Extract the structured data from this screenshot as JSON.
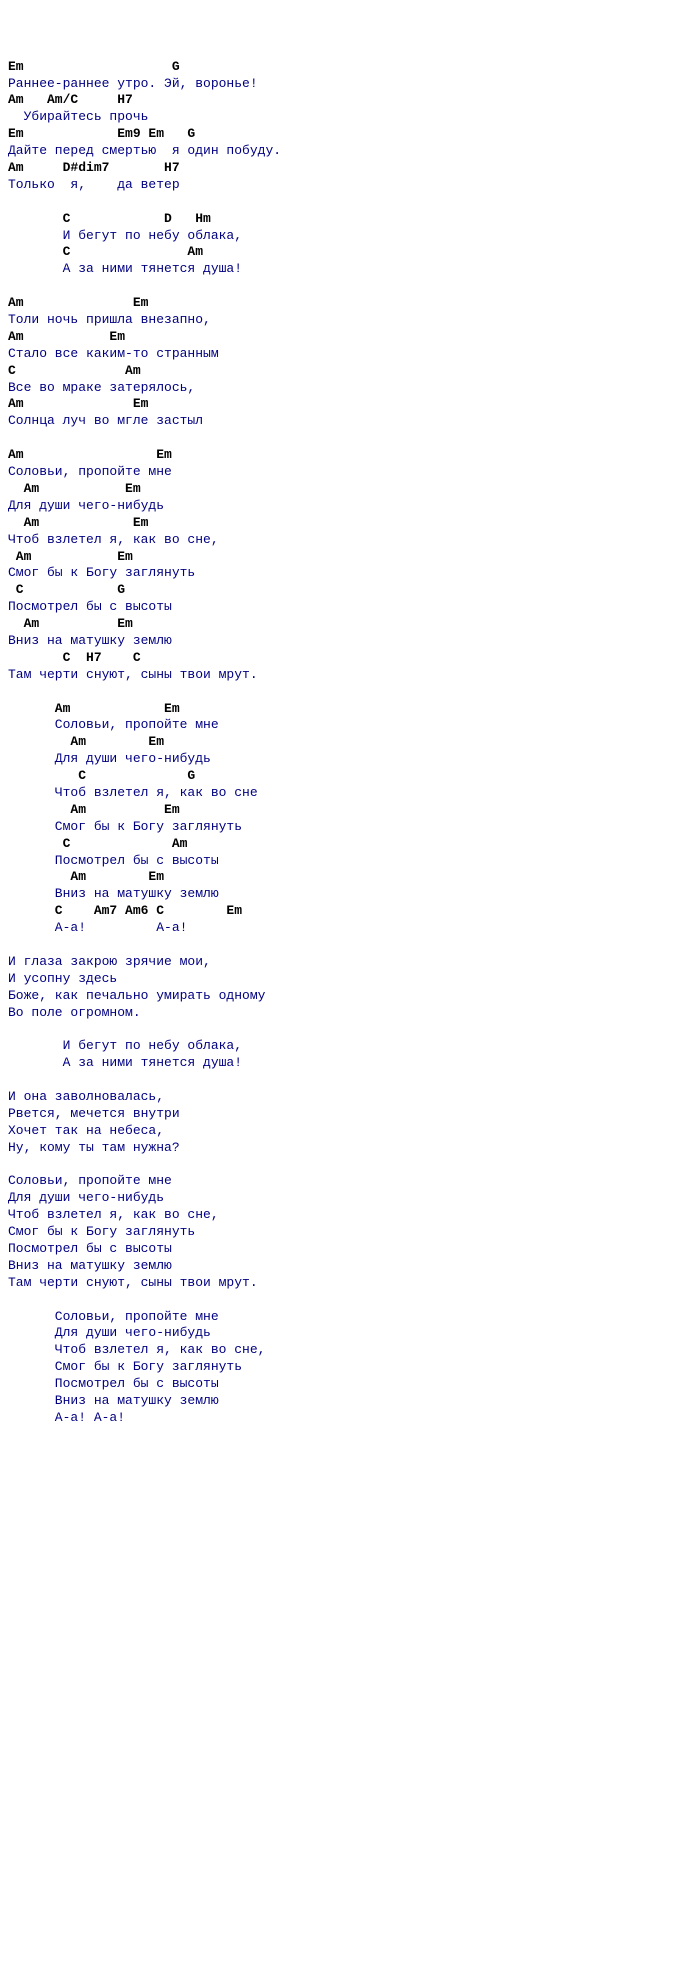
{
  "lines": [
    {
      "type": "chord",
      "text": "Em                   G"
    },
    {
      "type": "lyric",
      "text": "Раннее-раннее утро. Эй, воронье!"
    },
    {
      "type": "chord",
      "text": "Am   Am/C     H7"
    },
    {
      "type": "lyric",
      "text": "  Убирайтесь прочь"
    },
    {
      "type": "chord",
      "text": "Em            Em9 Em   G"
    },
    {
      "type": "lyric",
      "text": "Дайте перед смертью  я один побуду."
    },
    {
      "type": "chord",
      "text": "Am     D#dim7       H7"
    },
    {
      "type": "lyric",
      "text": "Только  я,    да ветер"
    },
    {
      "type": "blank",
      "text": ""
    },
    {
      "type": "chord",
      "text": "       C            D   Hm"
    },
    {
      "type": "lyric",
      "text": "       И бегут по небу облака,"
    },
    {
      "type": "chord",
      "text": "       C               Am"
    },
    {
      "type": "lyric",
      "text": "       А за ними тянется душа!"
    },
    {
      "type": "blank",
      "text": ""
    },
    {
      "type": "chord",
      "text": "Am              Em"
    },
    {
      "type": "lyric",
      "text": "Толи ночь пришла внезапно,"
    },
    {
      "type": "chord",
      "text": "Am           Em"
    },
    {
      "type": "lyric",
      "text": "Стало все каким-то странным"
    },
    {
      "type": "chord",
      "text": "C              Am"
    },
    {
      "type": "lyric",
      "text": "Все во мраке затерялось,"
    },
    {
      "type": "chord",
      "text": "Am              Em"
    },
    {
      "type": "lyric",
      "text": "Солнца луч во мгле застыл"
    },
    {
      "type": "blank",
      "text": ""
    },
    {
      "type": "chord",
      "text": "Am                 Em"
    },
    {
      "type": "lyric",
      "text": "Соловьи, пропойте мне"
    },
    {
      "type": "chord",
      "text": "  Am           Em"
    },
    {
      "type": "lyric",
      "text": "Для души чего-нибудь"
    },
    {
      "type": "chord",
      "text": "  Am            Em"
    },
    {
      "type": "lyric",
      "text": "Чтоб взлетел я, как во сне,"
    },
    {
      "type": "chord",
      "text": " Am           Em"
    },
    {
      "type": "lyric",
      "text": "Смог бы к Богу заглянуть"
    },
    {
      "type": "chord",
      "text": " C            G"
    },
    {
      "type": "lyric",
      "text": "Посмотрел бы с высоты"
    },
    {
      "type": "chord",
      "text": "  Am          Em"
    },
    {
      "type": "lyric",
      "text": "Вниз на матушку землю"
    },
    {
      "type": "chord",
      "text": "       C  H7    C"
    },
    {
      "type": "lyric",
      "text": "Там черти снуют, сыны твои мрут."
    },
    {
      "type": "blank",
      "text": ""
    },
    {
      "type": "chord",
      "text": "      Am            Em"
    },
    {
      "type": "lyric",
      "text": "      Соловьи, пропойте мне"
    },
    {
      "type": "chord",
      "text": "        Am        Em"
    },
    {
      "type": "lyric",
      "text": "      Для души чего-нибудь"
    },
    {
      "type": "chord",
      "text": "         C             G"
    },
    {
      "type": "lyric",
      "text": "      Чтоб взлетел я, как во сне"
    },
    {
      "type": "chord",
      "text": "        Am          Em"
    },
    {
      "type": "lyric",
      "text": "      Смог бы к Богу заглянуть"
    },
    {
      "type": "chord",
      "text": "       C             Am"
    },
    {
      "type": "lyric",
      "text": "      Посмотрел бы с высоты"
    },
    {
      "type": "chord",
      "text": "        Am        Em"
    },
    {
      "type": "lyric",
      "text": "      Вниз на матушку землю"
    },
    {
      "type": "chord",
      "text": "      C    Am7 Am6 C        Em"
    },
    {
      "type": "lyric",
      "text": "      А-а!         А-а!"
    },
    {
      "type": "blank",
      "text": ""
    },
    {
      "type": "lyric",
      "text": "И глаза закрою зрячие мои,"
    },
    {
      "type": "lyric",
      "text": "И усопну здесь"
    },
    {
      "type": "lyric",
      "text": "Боже, как печально умирать одному"
    },
    {
      "type": "lyric",
      "text": "Во поле огромном."
    },
    {
      "type": "blank",
      "text": ""
    },
    {
      "type": "lyric",
      "text": "       И бегут по небу облака,"
    },
    {
      "type": "lyric",
      "text": "       А за ними тянется душа!"
    },
    {
      "type": "blank",
      "text": ""
    },
    {
      "type": "lyric",
      "text": "И она заволновалась,"
    },
    {
      "type": "lyric",
      "text": "Рвется, мечется внутри"
    },
    {
      "type": "lyric",
      "text": "Хочет так на небеса,"
    },
    {
      "type": "lyric",
      "text": "Ну, кому ты там нужна?"
    },
    {
      "type": "blank",
      "text": ""
    },
    {
      "type": "lyric",
      "text": "Соловьи, пропойте мне"
    },
    {
      "type": "lyric",
      "text": "Для души чего-нибудь"
    },
    {
      "type": "lyric",
      "text": "Чтоб взлетел я, как во сне,"
    },
    {
      "type": "lyric",
      "text": "Смог бы к Богу заглянуть"
    },
    {
      "type": "lyric",
      "text": "Посмотрел бы с высоты"
    },
    {
      "type": "lyric",
      "text": "Вниз на матушку землю"
    },
    {
      "type": "lyric",
      "text": "Там черти снуют, сыны твои мрут."
    },
    {
      "type": "blank",
      "text": ""
    },
    {
      "type": "lyric",
      "text": "      Соловьи, пропойте мне"
    },
    {
      "type": "lyric",
      "text": "      Для души чего-нибудь"
    },
    {
      "type": "lyric",
      "text": "      Чтоб взлетел я, как во сне,"
    },
    {
      "type": "lyric",
      "text": "      Смог бы к Богу заглянуть"
    },
    {
      "type": "lyric",
      "text": "      Посмотрел бы с высоты"
    },
    {
      "type": "lyric",
      "text": "      Вниз на матушку землю"
    },
    {
      "type": "lyric",
      "text": "      А-а! А-а!"
    }
  ]
}
